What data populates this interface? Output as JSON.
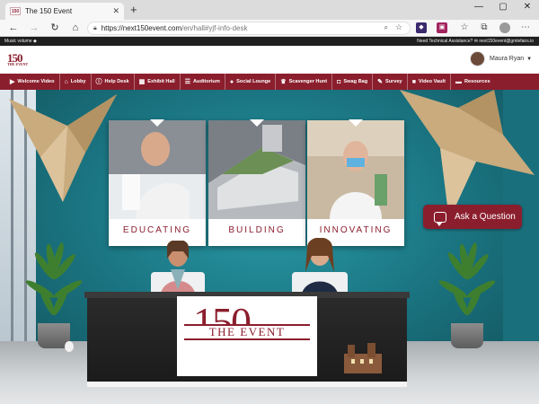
{
  "browser": {
    "tab_title": "The 150 Event",
    "tab_favicon_text": "150",
    "tab_close": "✕",
    "new_tab": "+",
    "window_controls": [
      "—",
      "▢",
      "✕"
    ],
    "url_host": "https://next150event.com",
    "url_path": "/en/hall#yjf-info-desk",
    "icons": [
      "back-arrow-icon",
      "forward-arrow-icon",
      "refresh-icon",
      "home-icon",
      "lock-icon",
      "zoom-icon",
      "star-icon",
      "favorites-icon",
      "collections-icon",
      "profile-icon",
      "menu-icon"
    ]
  },
  "site_bar": {
    "music_label": "Music volume",
    "help_text": "Need Technical Assistance?",
    "help_email": "next150event@gmlefairs.io"
  },
  "header": {
    "logo_text": "150",
    "logo_subtext": "THE EVENT",
    "user_name": "Maura Ryan"
  },
  "nav": {
    "items": [
      {
        "label": "Welcome Video",
        "icon": "play-icon"
      },
      {
        "label": "Lobby",
        "icon": "home-icon"
      },
      {
        "label": "Help Desk",
        "icon": "info-icon"
      },
      {
        "label": "Exhibit Hall",
        "icon": "building-icon"
      },
      {
        "label": "Auditorium",
        "icon": "list-icon"
      },
      {
        "label": "Social Lounge",
        "icon": "chat-icon"
      },
      {
        "label": "Scavenger Hunt",
        "icon": "trophy-icon"
      },
      {
        "label": "Swag Bag",
        "icon": "gift-icon"
      },
      {
        "label": "Survey",
        "icon": "survey-icon"
      },
      {
        "label": "Video Vault",
        "icon": "video-icon"
      },
      {
        "label": "Resources",
        "icon": "folder-icon"
      }
    ]
  },
  "scene": {
    "panels": [
      "EDUCATING",
      "BUILDING",
      "INNOVATING"
    ],
    "ask_button": "Ask a Question",
    "desk_logo_number": "150",
    "desk_logo_text": "THE EVENT"
  },
  "colors": {
    "brand": "#8b1e2d",
    "wall": "#1b7683",
    "chrome": "#dcdcdc"
  }
}
